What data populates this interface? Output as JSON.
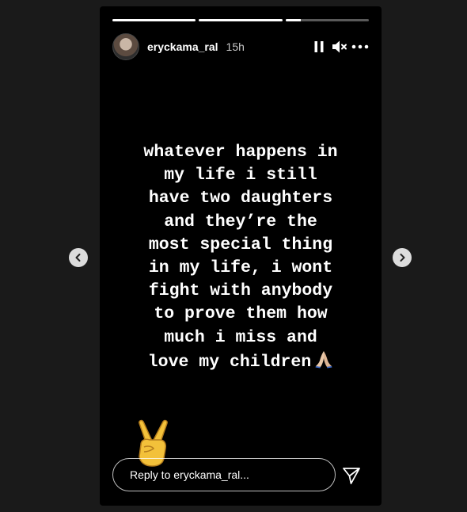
{
  "story": {
    "progress": [
      1.0,
      1.0,
      0.18
    ],
    "user": {
      "username": "eryckama_ral",
      "time": "15h"
    },
    "header_icons": [
      "pause-icon",
      "muted-speaker-icon",
      "more-options-icon"
    ],
    "text_lines": [
      "whatever happens in",
      "my life i still",
      "have two daughters",
      "and they’re the",
      "most special thing",
      "in my life, i wont",
      "fight with anybody",
      "to prove them how",
      "much i miss and",
      "love my children"
    ],
    "text_emoji": "folded-hands-emoji",
    "sticker": "victory-hand-emoji",
    "reply": {
      "placeholder": "Reply to eryckama_ral..."
    },
    "send_icon": "send-icon"
  },
  "navigation": {
    "previous_icon": "chevron-left-icon",
    "next_icon": "chevron-right-icon"
  },
  "colors": {
    "page_background": "#1a1a1a",
    "story_background": "#000000",
    "text": "#ffffff",
    "nav_button": "#dcdcdc"
  }
}
